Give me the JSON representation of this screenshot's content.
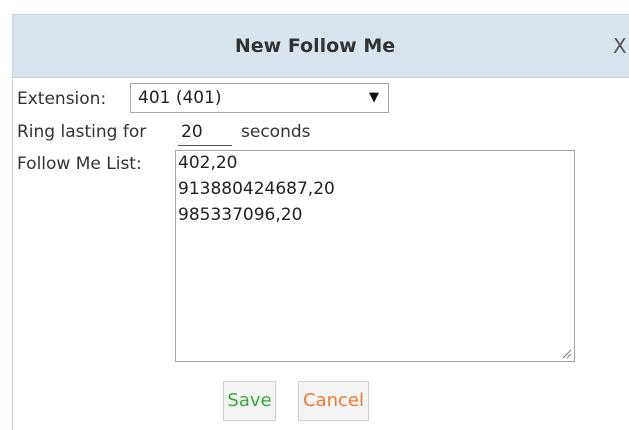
{
  "dialog": {
    "title": "New Follow Me",
    "close_label": "X"
  },
  "form": {
    "extension_label": "Extension:",
    "extension_value": "401 (401)",
    "ring_label": "Ring lasting for",
    "ring_value": "20",
    "ring_unit": "seconds",
    "list_label": "Follow Me List:",
    "list_entries": [
      "402,20",
      "913880424687,20",
      "985337096,20"
    ]
  },
  "buttons": {
    "save_label": "Save",
    "cancel_label": "Cancel"
  },
  "colors": {
    "title_bar": "#d9e4ef",
    "save_text": "#3aa83a",
    "cancel_text": "#f07a2c"
  }
}
